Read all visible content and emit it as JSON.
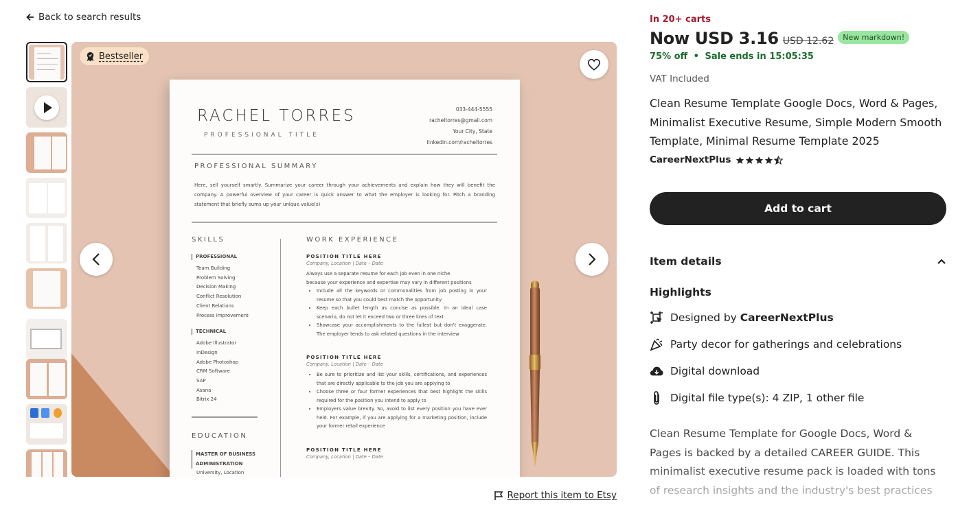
{
  "nav": {
    "back_label": "Back to search results"
  },
  "gallery": {
    "badge_label": "Bestseller",
    "thumbnail_count": 10
  },
  "resume": {
    "name": "RACHEL TORRES",
    "professional_title": "PROFESSIONAL TITLE",
    "contact": {
      "phone": "033-444-5555",
      "email": "racheltorres@gmail.com",
      "city": "Your City, State",
      "linkedin": "linkedin.com/racheltorres"
    },
    "summary_heading": "PROFESSIONAL SUMMARY",
    "summary_text": "Here, sell yourself smartly. Summarize your career through your achievements and explain how they will benefit the company. A powerful overview of your career is quick answer to what the employer is looking for. Pitch a branding statement that briefly sums up your unique value(s)",
    "skills_heading": "SKILLS",
    "skills_professional_label": "PROFESSIONAL",
    "skills_professional": [
      "Team Building",
      "Problem Solving",
      "Decision Making",
      "Conflict Resolution",
      "Client Relations",
      "Process Improvement"
    ],
    "skills_technical_label": "TECHNICAL",
    "skills_technical": [
      "Adobe Illustrator",
      "InDesign",
      "Adobe Photoshop",
      "CRM Software",
      "SAP",
      "Asana",
      "Bitrix 24"
    ],
    "education_heading": "EDUCATION",
    "education_degree_line1": "MASTER OF BUSINESS",
    "education_degree_line2": "ADMINISTRATION",
    "education_location": "University, Location",
    "work_heading": "WORK EXPERIENCE",
    "position_title": "POSITION TITLE HERE",
    "company_line": "Company, Location | Date – Date",
    "work1_intro_1": "Always use a separate resume for each job even in one niche",
    "work1_intro_2": "because your experience and expertise may vary in different positions",
    "work1_bullets": [
      "Include all the keywords or commonalities from job posting in your resume so that you could best match the opportunity",
      "Keep each bullet length as concise as possible. In an ideal case scenario, do not let it exceed two or three lines of text",
      "Showcase your accomplishments to the fullest but don't exaggerate. The employer tends to ask related questions in the interview"
    ],
    "work2_bullets": [
      "Be sure to prioritize and list your skills, certifications, and experiences that are directly applicable to the job you are applying to",
      "Choose three or four former experiences that best highlight the skills required for the position you intend to apply to",
      "Employers value brevity. So, avoid to list every position you have ever held. For example, if you are applying for a marketing position, include your former retail experience"
    ]
  },
  "report_label": "Report this item to Etsy",
  "listing": {
    "carts_label": "In 20+ carts",
    "price_now": "Now USD 3.16",
    "price_old": "USD 12.62",
    "markdown_badge": "New markdown!",
    "discount": "75% off",
    "sale_sep": "•",
    "sale_ends": "Sale ends in 15:05:35",
    "vat": "VAT Included",
    "title": "Clean Resume Template Google Docs, Word & Pages, Minimalist Executive Resume, Simple Modern Smooth Template, Minimal Resume Template 2025",
    "shop_name": "CareerNextPlus",
    "rating_stars": 4.5,
    "add_to_cart": "Add to cart",
    "item_details": "Item details",
    "highlights_heading": "Highlights",
    "highlight_designed_prefix": "Designed by ",
    "highlight_designed_shop": "CareerNextPlus",
    "highlight_party": "Party decor for gatherings and celebrations",
    "highlight_download": "Digital download",
    "highlight_filetype": "Digital file type(s): 4 ZIP, 1 other file",
    "description": "Clean Resume Template for Google Docs, Word & Pages is backed by a detailed CAREER GUIDE. This minimalist executive resume pack is loaded with tons of research insights and the industry's best practices"
  },
  "colors": {
    "image_background": "#e4c3b2",
    "accent_orange": "#c98a62",
    "cart_button": "#222222",
    "carts_text": "#a61a2e",
    "sale_text": "#1c6b2c",
    "markdown_badge_bg": "#9ae6a0"
  },
  "icons": {
    "back": "arrow-left-icon",
    "badge": "award-icon",
    "favorite": "heart-icon",
    "prev": "chevron-left-icon",
    "next": "chevron-right-icon",
    "report": "flag-icon",
    "collapse": "chevron-up-icon",
    "designed": "designer-frame-icon",
    "party": "party-popper-icon",
    "download": "cloud-download-icon",
    "file": "paperclip-icon"
  }
}
